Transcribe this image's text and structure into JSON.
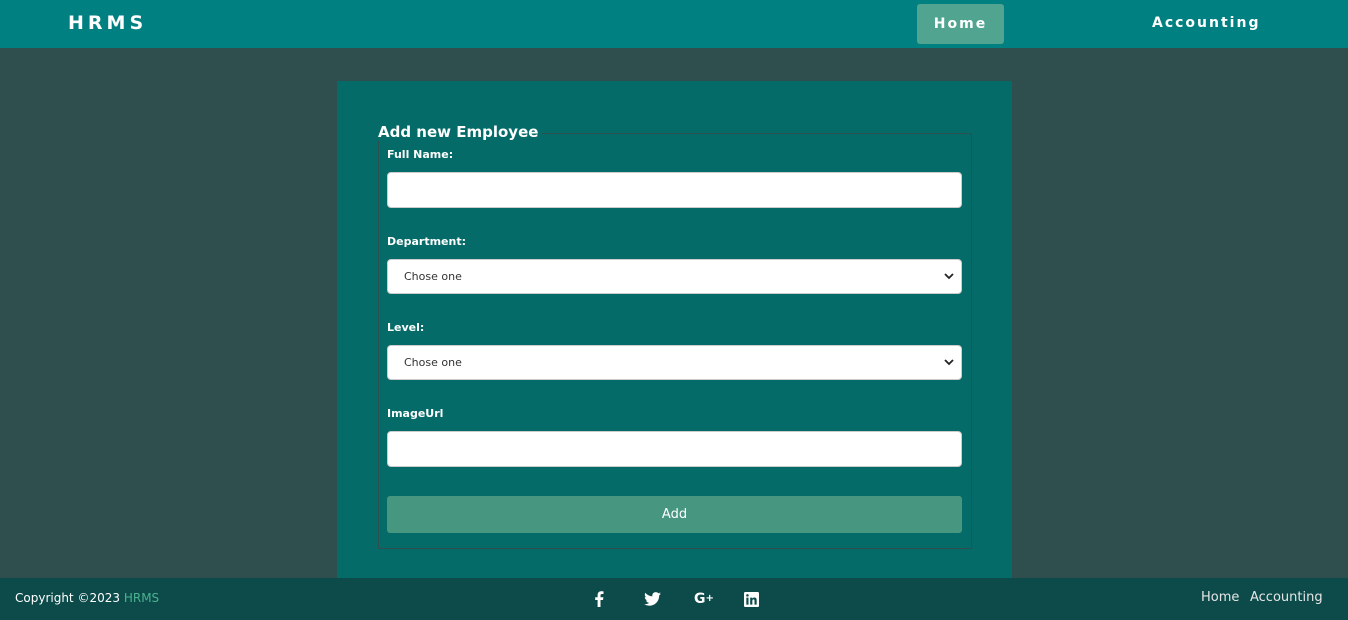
{
  "navbar": {
    "brand": "HRMS",
    "home": "Home",
    "accounting": "Accounting"
  },
  "form": {
    "legend": "Add new Employee",
    "full_name_label": "Full Name:",
    "full_name_value": "",
    "department_label": "Department:",
    "department_value": "Chose one",
    "level_label": "Level:",
    "level_value": "Chose one",
    "image_url_label": "ImageUrl",
    "image_url_value": "",
    "submit_label": "Add"
  },
  "footer": {
    "copyright_prefix": "Copyright ©2023",
    "copyright_brand": "HRMS",
    "social_icons": [
      "facebook-icon",
      "twitter-icon",
      "google-plus-icon",
      "linkedin-icon"
    ],
    "links": [
      "Home",
      "Accounting"
    ]
  },
  "colors": {
    "navbar": "#008080",
    "background": "#2f4f4f",
    "card": "#046b68",
    "button": "#47967f",
    "footer": "#0c4b4a",
    "accent": "#4ab38f"
  }
}
